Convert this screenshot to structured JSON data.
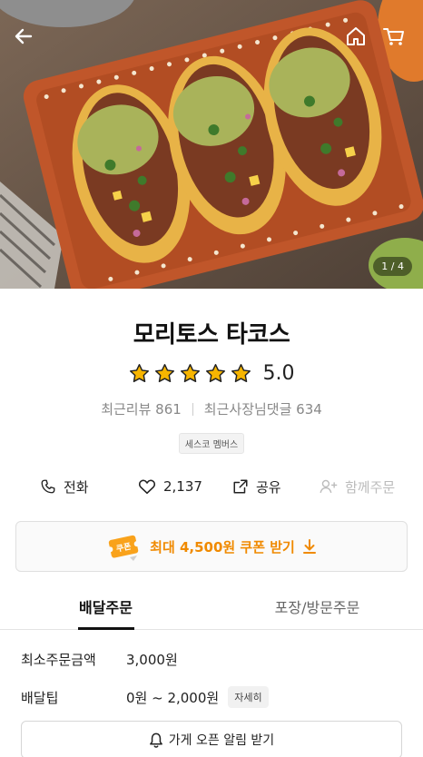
{
  "hero": {
    "photo_counter": "1 / 4",
    "icons": {
      "back": "back-arrow-icon",
      "home": "home-icon",
      "cart": "cart-icon"
    }
  },
  "store": {
    "name": "모리토스 타코스",
    "rating": "5.0",
    "rating_stars": 5,
    "recent_reviews": "최근리뷰 861",
    "recent_owner_replies": "최근사장님댓글 634",
    "badge": "세스코 멤버스"
  },
  "actions": {
    "call": "전화",
    "likes": "2,137",
    "share": "공유",
    "group_order": "함께주문"
  },
  "coupon": {
    "label": "최대 4,500원 쿠폰 받기",
    "icon_text": "쿠폰"
  },
  "tabs": [
    {
      "label": "배달주문",
      "active": true
    },
    {
      "label": "포장/방문주문",
      "active": false
    }
  ],
  "delivery": {
    "min_order_label": "최소주문금액",
    "min_order_value": "3,000원",
    "tip_label": "배달팁",
    "tip_value": "0원 ~ 2,000원",
    "detail_button": "자세히",
    "alarm_button": "가게 오픈 알림 받기"
  },
  "colors": {
    "accent": "#f08a00",
    "star": "#f7b500",
    "text": "#222222",
    "muted": "#888888"
  }
}
